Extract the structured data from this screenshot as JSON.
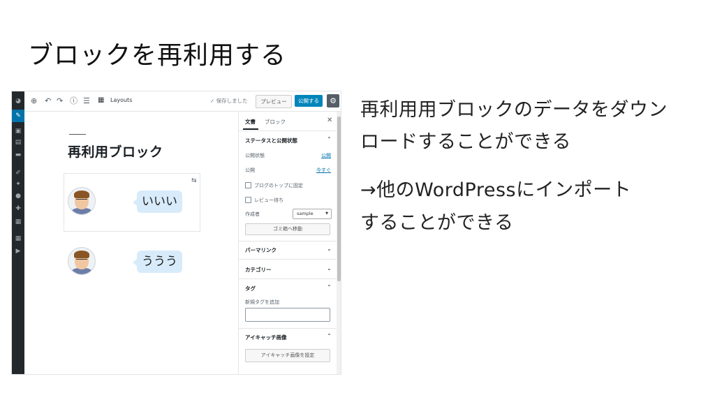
{
  "slide": {
    "title": "ブロックを再利用する",
    "point1_line1": "再利用用ブロックのデータをダウン",
    "point1_line2": "ロードすることができる",
    "point2_line1": "→他のWordPressにインポート",
    "point2_line2": "することができる"
  },
  "toolbar": {
    "layouts_label": "Layouts",
    "saved_label": "✓ 保存しました",
    "preview_label": "プレビュー",
    "publish_label": "公開する"
  },
  "editor": {
    "post_title": "再利用ブロック",
    "bubble1": "いいい",
    "bubble2": "ううう"
  },
  "sidebar": {
    "tab_document": "文書",
    "tab_block": "ブロック",
    "close": "✕",
    "status_panel_title": "ステータスと公開状態",
    "visibility_label": "公開状態",
    "visibility_value": "公開",
    "publish_label": "公開",
    "publish_value": "今すぐ",
    "sticky_label": "ブログのトップに固定",
    "pending_label": "レビュー待ち",
    "author_label": "作成者",
    "author_value": "sample",
    "trash_button": "ゴミ箱へ移動",
    "permalink_title": "パーマリンク",
    "category_title": "カテゴリー",
    "tag_title": "タグ",
    "tag_add_label": "新規タグを追加",
    "eyecatch_title": "アイキャッチ画像",
    "eyecatch_button": "アイキャッチ画像を設定"
  },
  "colors": {
    "admin_bar": "#23282d",
    "accent": "#0085ba",
    "bubble": "#d8ebfa"
  }
}
